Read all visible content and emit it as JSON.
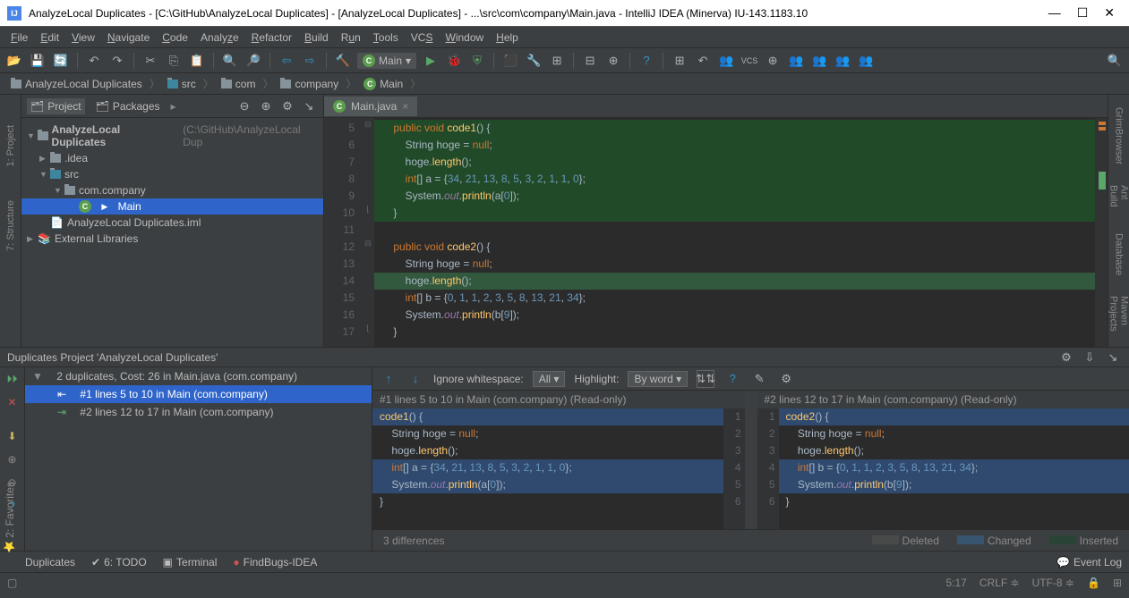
{
  "title": "AnalyzeLocal Duplicates - [C:\\GitHub\\AnalyzeLocal Duplicates] - [AnalyzeLocal Duplicates] - ...\\src\\com\\company\\Main.java - IntelliJ IDEA (Minerva) IU-143.1183.10",
  "menu": [
    "File",
    "Edit",
    "View",
    "Navigate",
    "Code",
    "Analyze",
    "Refactor",
    "Build",
    "Run",
    "Tools",
    "VCS",
    "Window",
    "Help"
  ],
  "run_config": "Main",
  "breadcrumbs": [
    "AnalyzeLocal Duplicates",
    "src",
    "com",
    "company",
    "Main"
  ],
  "project_panel": {
    "tabs": [
      "Project",
      "Packages"
    ],
    "tree": {
      "root": "AnalyzeLocal Duplicates",
      "root_hint": "(C:\\GitHub\\AnalyzeLocal Dup",
      "idea": ".idea",
      "src": "src",
      "pkg": "com.company",
      "main": "Main",
      "iml": "AnalyzeLocal Duplicates.iml",
      "ext": "External Libraries"
    }
  },
  "left_sidebar": [
    "1: Project",
    "7: Structure"
  ],
  "right_sidebar": [
    "GrimBrowser",
    "Ant Build",
    "Database",
    "Maven Projects"
  ],
  "editor_tab": "Main.java",
  "editor": {
    "lines": [
      {
        "n": 5,
        "text": "    public void code1() {",
        "hl": true
      },
      {
        "n": 6,
        "text": "        String hoge = null;",
        "hl": true
      },
      {
        "n": 7,
        "text": "        hoge.length();",
        "hl": true
      },
      {
        "n": 8,
        "text": "        int[] a = {34, 21, 13, 8, 5, 3, 2, 1, 1, 0};",
        "hl": true
      },
      {
        "n": 9,
        "text": "        System.out.println(a[0]);",
        "hl": true
      },
      {
        "n": 10,
        "text": "    }",
        "hl": true
      },
      {
        "n": 11,
        "text": ""
      },
      {
        "n": 12,
        "text": "    public void code2() {"
      },
      {
        "n": 13,
        "text": "        String hoge = null;"
      },
      {
        "n": 14,
        "text": "        hoge.length();",
        "caret": true
      },
      {
        "n": 15,
        "text": "        int[] b = {0, 1, 1, 2, 3, 5, 8, 13, 21, 34};"
      },
      {
        "n": 16,
        "text": "        System.out.println(b[9]);"
      },
      {
        "n": 17,
        "text": "    }"
      }
    ]
  },
  "duplicates": {
    "title": "Duplicates Project 'AnalyzeLocal Duplicates'",
    "summary": "2 duplicates, Cost: 26 in Main.java (com.company)",
    "items": [
      "#1 lines 5 to 10 in Main (com.company)",
      "#2 lines 12 to 17 in Main (com.company)"
    ],
    "diff_toolbar": {
      "ignore_ws": "Ignore whitespace:",
      "ignore_ws_val": "All",
      "highlight": "Highlight:",
      "highlight_val": "By word"
    },
    "pane1_title": "#1 lines 5 to 10 in Main (com.company) (Read-only)",
    "pane2_title": "#2 lines 12 to 17 in Main (com.company) (Read-only)",
    "pane1_lines": [
      "code1() {",
      "    String hoge = null;",
      "    hoge.length();",
      "    int[] a = {34, 21, 13, 8, 5, 3, 2, 1, 1, 0};",
      "    System.out.println(a[0]);",
      "}"
    ],
    "pane2_lines": [
      "code2() {",
      "    String hoge = null;",
      "    hoge.length();",
      "    int[] b = {0, 1, 1, 2, 3, 5, 8, 13, 21, 34};",
      "    System.out.println(b[9]);",
      "}"
    ],
    "diff_count": "3 differences",
    "legend": {
      "deleted": "Deleted",
      "changed": "Changed",
      "inserted": "Inserted"
    }
  },
  "bottom_tabs": {
    "dup": "Duplicates",
    "todo": "6: TODO",
    "term": "Terminal",
    "findbugs": "FindBugs-IDEA",
    "event": "Event Log"
  },
  "left_bottom_vert": "2: Favorites",
  "status": {
    "pos": "5:17",
    "eol": "CRLF",
    "enc": "UTF-8"
  }
}
